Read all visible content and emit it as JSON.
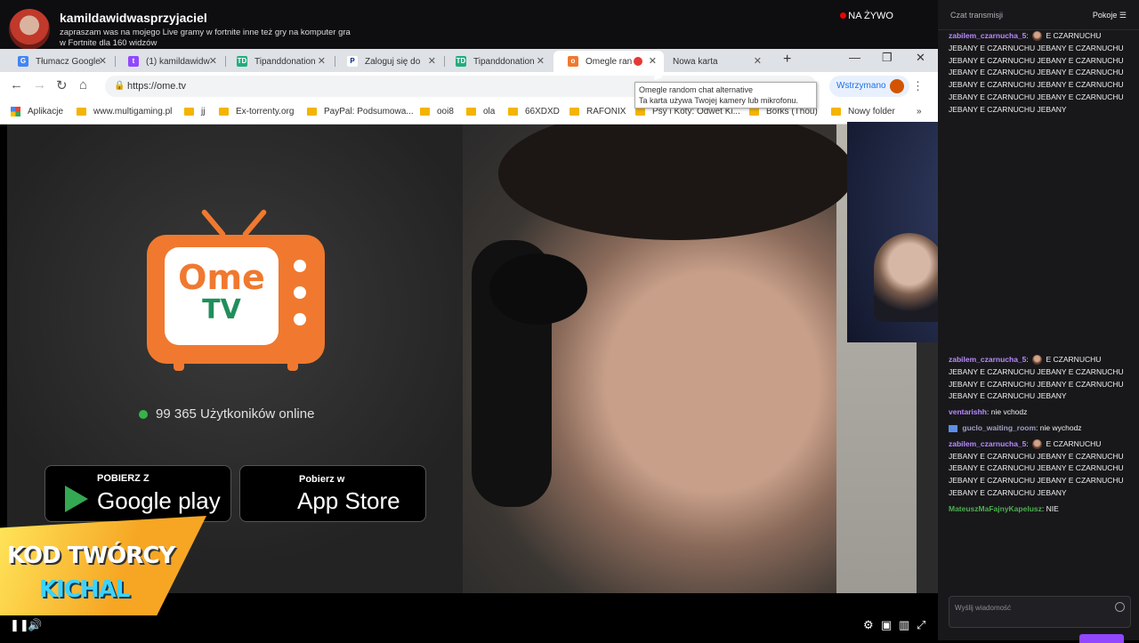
{
  "stream": {
    "channel": "kamildawidwasprzyjaciel",
    "description": "zapraszam was na mojego Live gramy w fortnite inne też gry na komputer gra w Fortnite dla 160 widzów",
    "live": "NA ŻYWO"
  },
  "browser": {
    "tabs": [
      {
        "label": "Tłumacz Google",
        "icon": "google-translate-icon"
      },
      {
        "label": "(1) kamildawidw",
        "icon": "twitch-icon"
      },
      {
        "label": "Tipanddonation",
        "icon": "td-icon"
      },
      {
        "label": "Zaloguj się do",
        "icon": "paypal-icon"
      },
      {
        "label": "Tipanddonation",
        "icon": "td-icon"
      },
      {
        "label": "Omegle ran",
        "icon": "omegle-icon",
        "active": true
      },
      {
        "label": "Nowa karta",
        "icon": "none"
      }
    ],
    "url": "https://ome.tv",
    "profile_label": "Wstrzymano",
    "bookmarks": [
      "Aplikacje",
      "www.multigaming.pl",
      "jj",
      "Ex-torrenty.org",
      "PayPal: Podsumowa...",
      "ooi8",
      "ola",
      "66XDXD",
      "RAFONIX",
      "Psy i Koty: Odwet Ki...",
      "Borks (Thou)",
      "Nowy folder"
    ],
    "tooltip_line1": "Omegle random chat alternative",
    "tooltip_line2": "Ta karta używa Twojej kamery lub mikrofonu."
  },
  "page": {
    "logo_top": "Ome",
    "logo_bottom": "TV",
    "online_count": "99 365 Użytkoników online",
    "google_small": "POBIERZ Z",
    "google_big": "Google play",
    "apple_small": "Pobierz w",
    "apple_big": "App Store"
  },
  "banner": {
    "line1": "KOD TWÓRCY",
    "line2": "KICHAL"
  },
  "chat": {
    "title": "Czat transmisji",
    "rooms": "Pokoje",
    "messages_top": [
      {
        "user": "zabilem_czarnucha_5",
        "color": "#b98aff",
        "text": "E CZARNUCHU JEBANY E CZARNUCHU JEBANY E CZARNUCHU JEBANY E CZARNUCHU JEBANY E CZARNUCHU JEBANY E CZARNUCHU JEBANY E CZARNUCHU JEBANY E CZARNUCHU JEBANY E CZARNUCHU JEBANY E CZARNUCHU JEBANY E CZARNUCHU JEBANY E CZARNUCHU JEBANY"
      }
    ],
    "messages_bottom": [
      {
        "user": "zabilem_czarnucha_5",
        "color": "#b98aff",
        "text": "E CZARNUCHU JEBANY E CZARNUCHU JEBANY E CZARNUCHU JEBANY E CZARNUCHU JEBANY E CZARNUCHU JEBANY E CZARNUCHU JEBANY"
      },
      {
        "user": "ventarishh",
        "color": "#b98aff",
        "text": "nie vchodz"
      },
      {
        "user": "guclo_waiting_room",
        "color": "#a0a0c0",
        "text": "nie wychodz"
      },
      {
        "user": "zabilem_czarnucha_5",
        "color": "#b98aff",
        "text": "E CZARNUCHU JEBANY E CZARNUCHU JEBANY E CZARNUCHU JEBANY E CZARNUCHU JEBANY E CZARNUCHU JEBANY E CZARNUCHU JEBANY E CZARNUCHU JEBANY E CZARNUCHU JEBANY"
      },
      {
        "user": "MateuszMaFajnyKapelusz",
        "color": "#4caf50",
        "text": "NIE"
      }
    ],
    "input_placeholder": "Wyślij wiadomość"
  }
}
